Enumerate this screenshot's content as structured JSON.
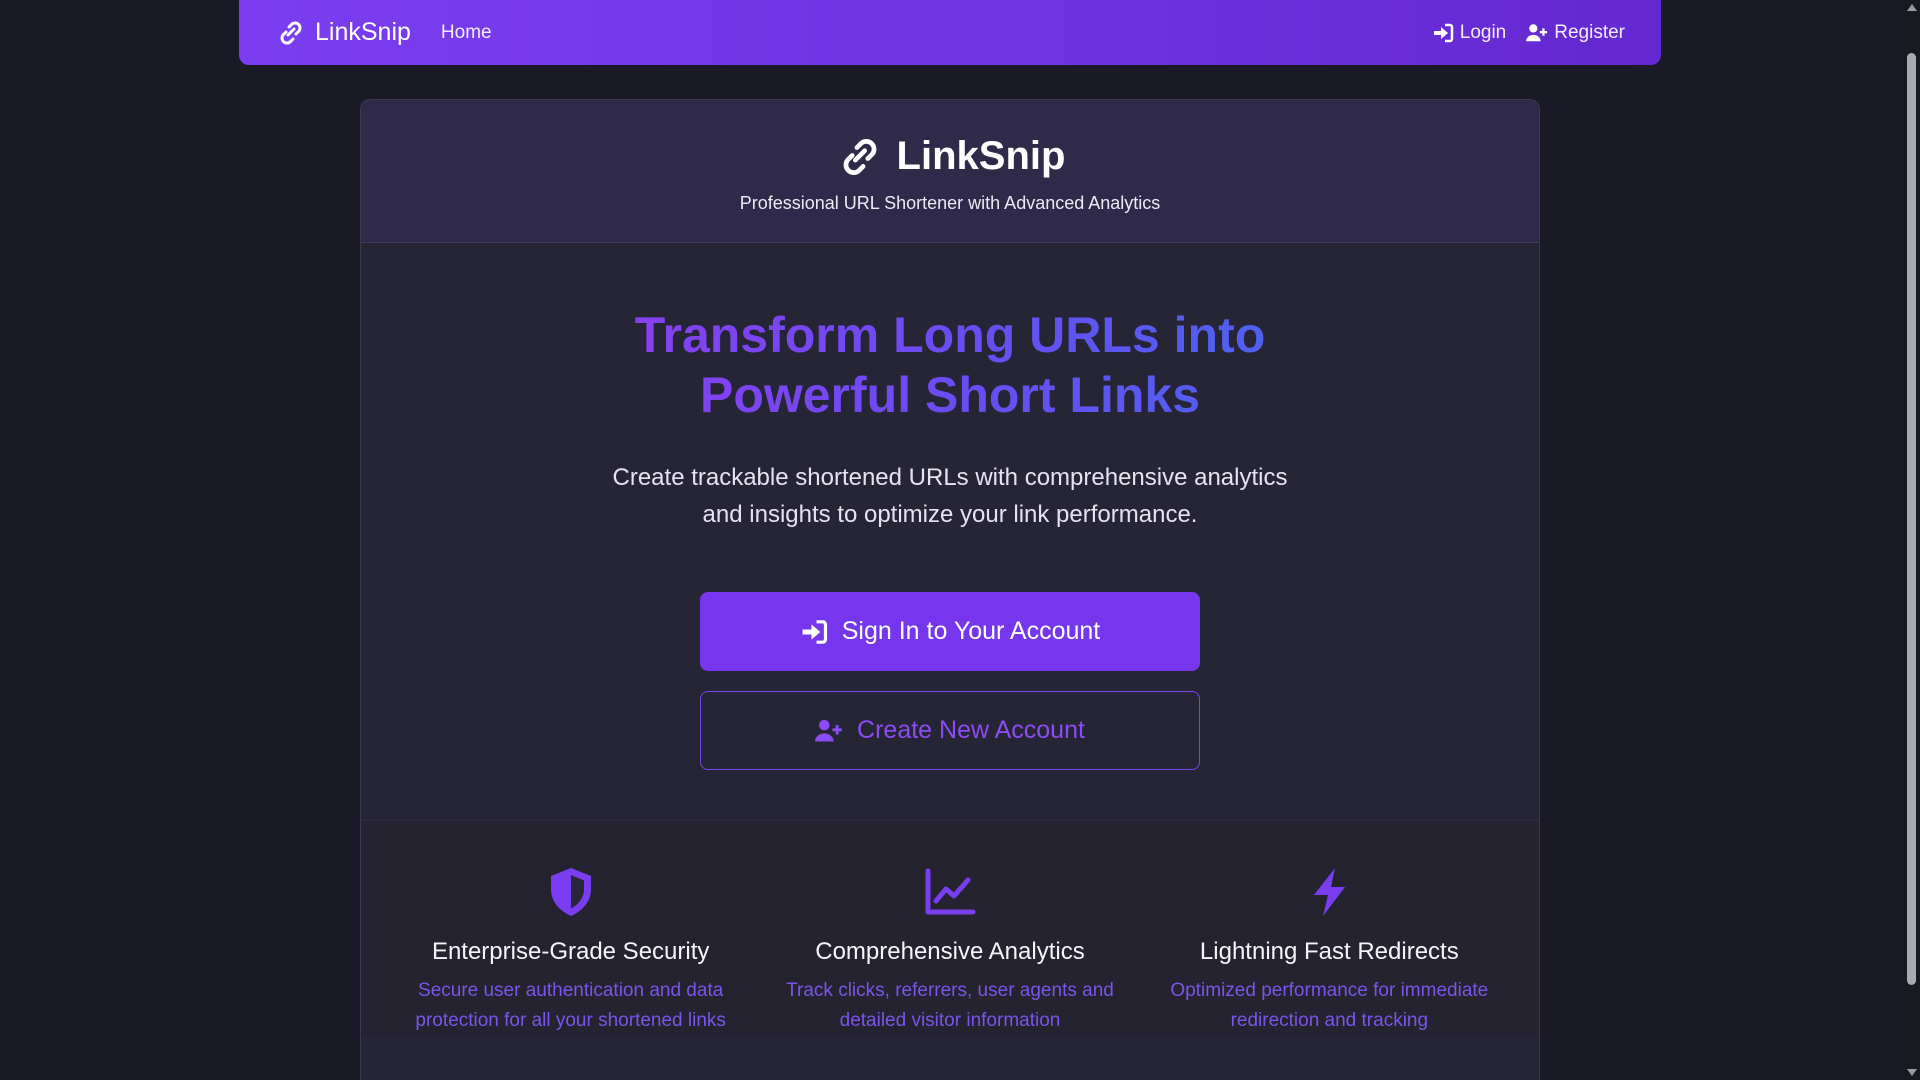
{
  "navbar": {
    "brand": "LinkSnip",
    "home": "Home",
    "login": "Login",
    "register": "Register"
  },
  "card": {
    "title": "LinkSnip",
    "subtitle": "Professional URL Shortener with Advanced Analytics"
  },
  "hero": {
    "headline_line1": "Transform Long URLs into",
    "headline_line2": "Powerful Short Links",
    "description": "Create trackable shortened URLs with comprehensive analytics and insights to optimize your link performance.",
    "primary_button": "Sign In to Your Account",
    "secondary_button": "Create New Account"
  },
  "features": [
    {
      "icon": "shield-icon",
      "title": "Enterprise-Grade Security",
      "text": "Secure user authentication and data protection for all your shortened links"
    },
    {
      "icon": "chart-line-icon",
      "title": "Comprehensive Analytics",
      "text": "Track clicks, referrers, user agents and detailed visitor information"
    },
    {
      "icon": "bolt-icon",
      "title": "Lightning Fast Redirects",
      "text": "Optimized performance for immediate redirection and tracking"
    }
  ],
  "colors": {
    "accent": "#7636ee",
    "navbar": "#6d33e0",
    "background": "#1a1a27",
    "card": "#262536"
  }
}
